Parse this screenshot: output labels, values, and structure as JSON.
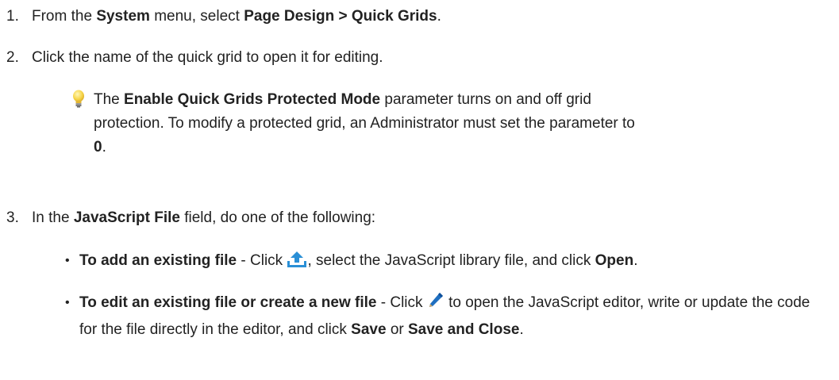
{
  "steps": [
    {
      "number": "1.",
      "p1": "From the ",
      "b1": "System",
      "p2": " menu, select ",
      "b2": "Page Design > Quick Grids",
      "p3": "."
    },
    {
      "number": "2.",
      "text": "Click the name of the quick grid to open it for editing."
    },
    {
      "number": "3.",
      "p1": "In the ",
      "b1": "JavaScript File",
      "p2": " field, do one of the following:"
    }
  ],
  "tip": {
    "icon": "lightbulb-icon",
    "p1": "The ",
    "b1": "Enable Quick Grids Protected Mode",
    "p2": " parameter turns on and off grid protection. To modify a protected grid, an Administrator must set the parameter to ",
    "b2": "0",
    "p3": "."
  },
  "bullets": [
    {
      "marker": "•",
      "b1": "To add an existing file",
      "p1": " - Click ",
      "icon": "upload-icon",
      "p2": ", select the JavaScript library file, and click ",
      "b2": "Open",
      "p3": "."
    },
    {
      "marker": "•",
      "b1": "To edit an existing file or create a new file",
      "p1": " - Click ",
      "icon": "pencil-icon",
      "p2": " to open the JavaScript editor, write or update the code for the file directly in the editor, and click ",
      "b2": "Save",
      "p3": " or ",
      "b3": "Save and Close",
      "p4": "."
    }
  ],
  "colors": {
    "text": "#222222",
    "upload_icon": "#2a8fd6",
    "pencil_icon": "#1f6fc0",
    "bulb": "#f7d64a"
  }
}
